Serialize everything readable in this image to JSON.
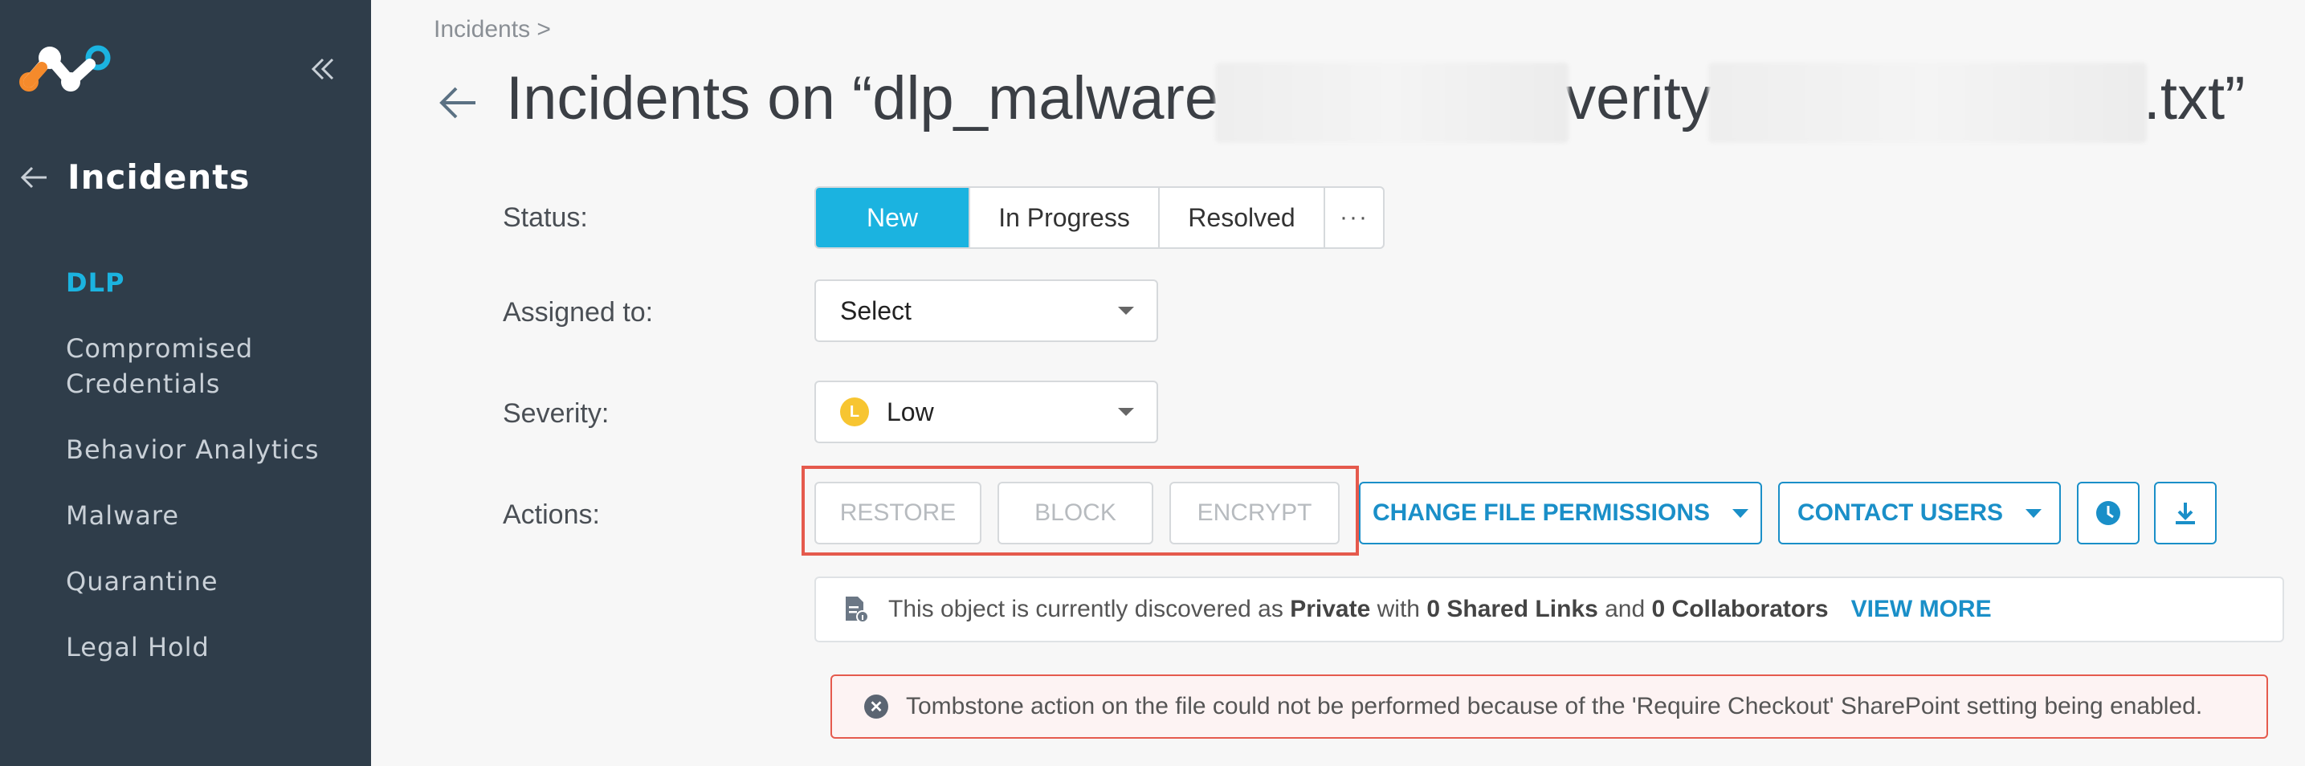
{
  "sidebar": {
    "title": "Incidents",
    "items": [
      {
        "label": "DLP"
      },
      {
        "label": "Compromised Credentials"
      },
      {
        "label": "Behavior Analytics"
      },
      {
        "label": "Malware"
      },
      {
        "label": "Quarantine"
      },
      {
        "label": "Legal Hold"
      }
    ]
  },
  "breadcrumb": "Incidents >",
  "page": {
    "title_prefix": "Incidents on “dlp_malware",
    "title_mid": "verity",
    "title_suffix": ".txt”"
  },
  "form": {
    "status_label": "Status:",
    "status_options": [
      "New",
      "In Progress",
      "Resolved",
      "···"
    ],
    "assigned_label": "Assigned to:",
    "assigned_value": "Select",
    "severity_label": "Severity:",
    "severity_value": "Low",
    "severity_badge": "L",
    "actions_label": "Actions:"
  },
  "actions": {
    "restore": "RESTORE",
    "block": "BLOCK",
    "encrypt": "ENCRYPT",
    "change_permissions": "CHANGE FILE PERMISSIONS",
    "contact_users": "CONTACT USERS"
  },
  "info": {
    "text1": "This object is currently discovered as",
    "visibility": "Private",
    "text2": "with",
    "shared_links": "0 Shared Links",
    "text3": "and",
    "collaborators": "0 Collaborators",
    "view_more": "VIEW MORE"
  },
  "error": {
    "message": "Tombstone action on the file could not be performed because of the 'Require Checkout' SharePoint setting being enabled."
  },
  "colors": {
    "sidebar_bg": "#2f3d4a",
    "accent": "#1bb3e0",
    "link": "#1a8fc8",
    "highlight": "#e55a4d",
    "severity_low": "#f7c531"
  },
  "icons": [
    "logo-icon",
    "collapse-icon",
    "back-arrow-icon",
    "clock-icon",
    "download-icon",
    "document-info-icon",
    "error-x-icon",
    "chevron-down-icon"
  ]
}
